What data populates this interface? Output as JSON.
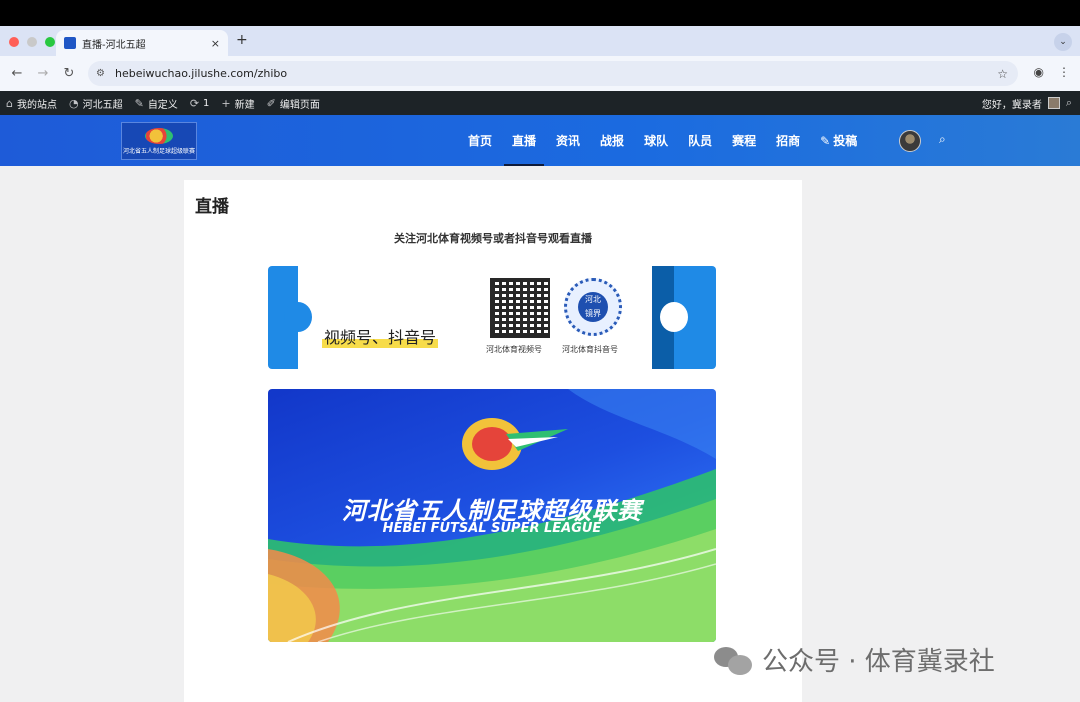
{
  "browser": {
    "tab_title": "直播-河北五超",
    "tab_close": "×",
    "new_tab": "+",
    "url": "hebeiwuchao.jilushe.com/zhibo"
  },
  "wp_admin_bar": {
    "items": [
      "我的站点",
      "河北五超",
      "自定义",
      "1",
      "新建",
      "编辑页面"
    ],
    "greeting": "您好，冀录者"
  },
  "site_header": {
    "logo_text": "河北省五人制足球超级联赛",
    "menu": [
      "首页",
      "直播",
      "资讯",
      "战报",
      "球队",
      "队员",
      "赛程",
      "招商",
      "投稿"
    ],
    "active_menu": "直播"
  },
  "content": {
    "page_title": "直播",
    "subtitle": "关注河北体育视频号或者抖音号观看直播",
    "qr_banner": {
      "label": "视频号、抖音号",
      "qr1_caption": "河北体育视频号",
      "qr2_caption": "河北体育抖音号",
      "qr2_center": "河北\n镜界"
    },
    "hero": {
      "title": "河北省五人制足球超级联赛",
      "subtitle": "HEBEI FUTSAL SUPER LEAGUE"
    }
  },
  "watermark": "公众号 · 体育冀录社",
  "colors": {
    "header_blue": "#1e5bd8",
    "wp_bar": "#1d2327",
    "accent_yellow": "#f7dc4a"
  }
}
